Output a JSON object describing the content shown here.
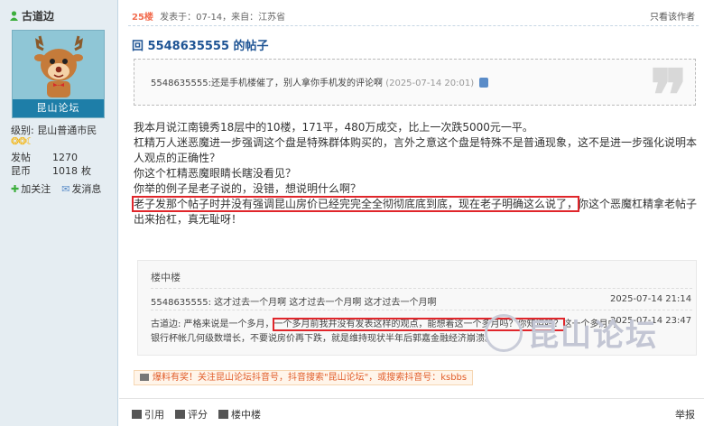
{
  "author": {
    "name": "古道边",
    "avatar_caption": "昆山论坛",
    "level_label": "级别:",
    "level": "昆山普通市民",
    "stars": "❂❂☾",
    "stats": [
      {
        "key": "发帖",
        "value": "1270",
        "unit": ""
      },
      {
        "key": "昆币",
        "value": "1018",
        "unit": "枚"
      }
    ],
    "add_friend": "加关注",
    "message": "发消息"
  },
  "post": {
    "floor": "25楼",
    "meta": "发表于：07-14，来自：江苏省",
    "only_author": "只看该作者",
    "reply_prefix": "回",
    "reply_user": "5548635555",
    "reply_suffix": "的帖子",
    "quote_text": "5548635555:还是手机楼催了，别人拿你手机发的评论啊",
    "quote_time": "(2025-07-14 20:01)",
    "body": [
      "我本月说江南镜秀18层中的10楼，171平，480万成交，比上一次跌5000元一平。",
      "杠精万人迷恶魔进一步强调这个盘是特殊群体购买的，言外之意这个盘是特殊不是普通现象，这不是进一步强化说明本人观点的正确性？",
      "你这个杠精恶魔眼睛长瞎没看见？",
      "你举的例子是老子说的，没错，想说明什么啊？"
    ],
    "highlight": "老子发那个帖子时并没有强调昆山房价已经完完全全彻彻底底到底，现在老子明确这么说了，",
    "after_highlight": "你这个恶魔杠精拿老帖子出来抬杠，真无耻呀！"
  },
  "sub_replies": {
    "title": "楼中楼",
    "items": [
      {
        "text": "5548635555: 这才过去一个月啊 这才过去一个月啊 这才过去一个月啊",
        "time": "2025-07-14 21:14"
      },
      {
        "pre": "古道边: 严格来说是一个多月，",
        "hl": "一个多月前我并没有发表这样的观点，能想着这一个多月吗？你知道吗？",
        "post": "这一个多月内",
        "time": "2025-07-14 23:47",
        "cont": "银行杯帐几何级数增长，不要说房价再下跌，就是维持现状半年后郭嘉金融经济崩溃。"
      }
    ],
    "watermark": "昆山论坛"
  },
  "promo": "爆料有奖！关注昆山论坛抖音号，抖音搜索\"昆山论坛\"，或搜索抖音号：ksbbs",
  "footer": {
    "quote_btn": "引用",
    "rate_btn": "评分",
    "lzl_btn": "楼中楼",
    "report": "举报"
  }
}
